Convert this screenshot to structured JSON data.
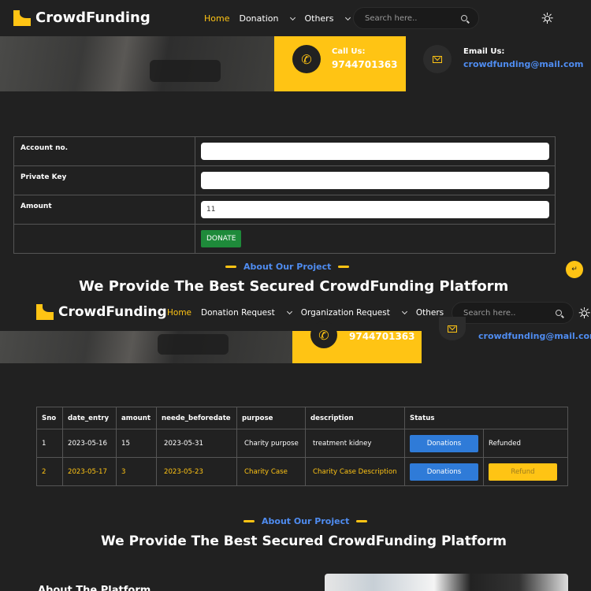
{
  "brand": {
    "name": "CrowdFunding",
    "accent": "#ffc414",
    "link": "#4f8cf0"
  },
  "nav_top": {
    "links": [
      "Home",
      "Donation",
      "Others"
    ],
    "search_placeholder": "Search here.."
  },
  "contact": {
    "call_label": "Call Us:",
    "call_number": "9744701363",
    "email_label": "Email Us:",
    "email": "crowdfunding@mail.com"
  },
  "donate_form": {
    "account_label": "Account no.",
    "account_value": "",
    "key_label": "Private Key",
    "key_value": "",
    "amount_label": "Amount",
    "amount_value": "11",
    "button": "DONATE"
  },
  "about": {
    "tag": "About Our Project",
    "headline": "We Provide The Best Secured CrowdFunding Platform"
  },
  "nav_second": {
    "links": [
      "Home",
      "Donation Request",
      "Organization Request",
      "Others"
    ],
    "search_placeholder": "Search here.."
  },
  "requests_table": {
    "headers": [
      "Sno",
      "date_entry",
      "amount",
      "neede_beforedate",
      "purpose",
      "description",
      "Status"
    ],
    "rows": [
      {
        "sno": "1",
        "date_entry": "2023-05-16",
        "amount": "15",
        "needed": "2023-05-31",
        "purpose": "Charity purpose",
        "description": "treatment kidney",
        "action": "Donations",
        "status": "Refunded"
      },
      {
        "sno": "2",
        "date_entry": "2023-05-17",
        "amount": "3",
        "needed": "2023-05-23",
        "purpose": "Charity Case",
        "description": "Charity Case Description",
        "action": "Donations",
        "status": "Refund"
      }
    ]
  },
  "bottom": {
    "partial_heading": "About The Platform"
  }
}
